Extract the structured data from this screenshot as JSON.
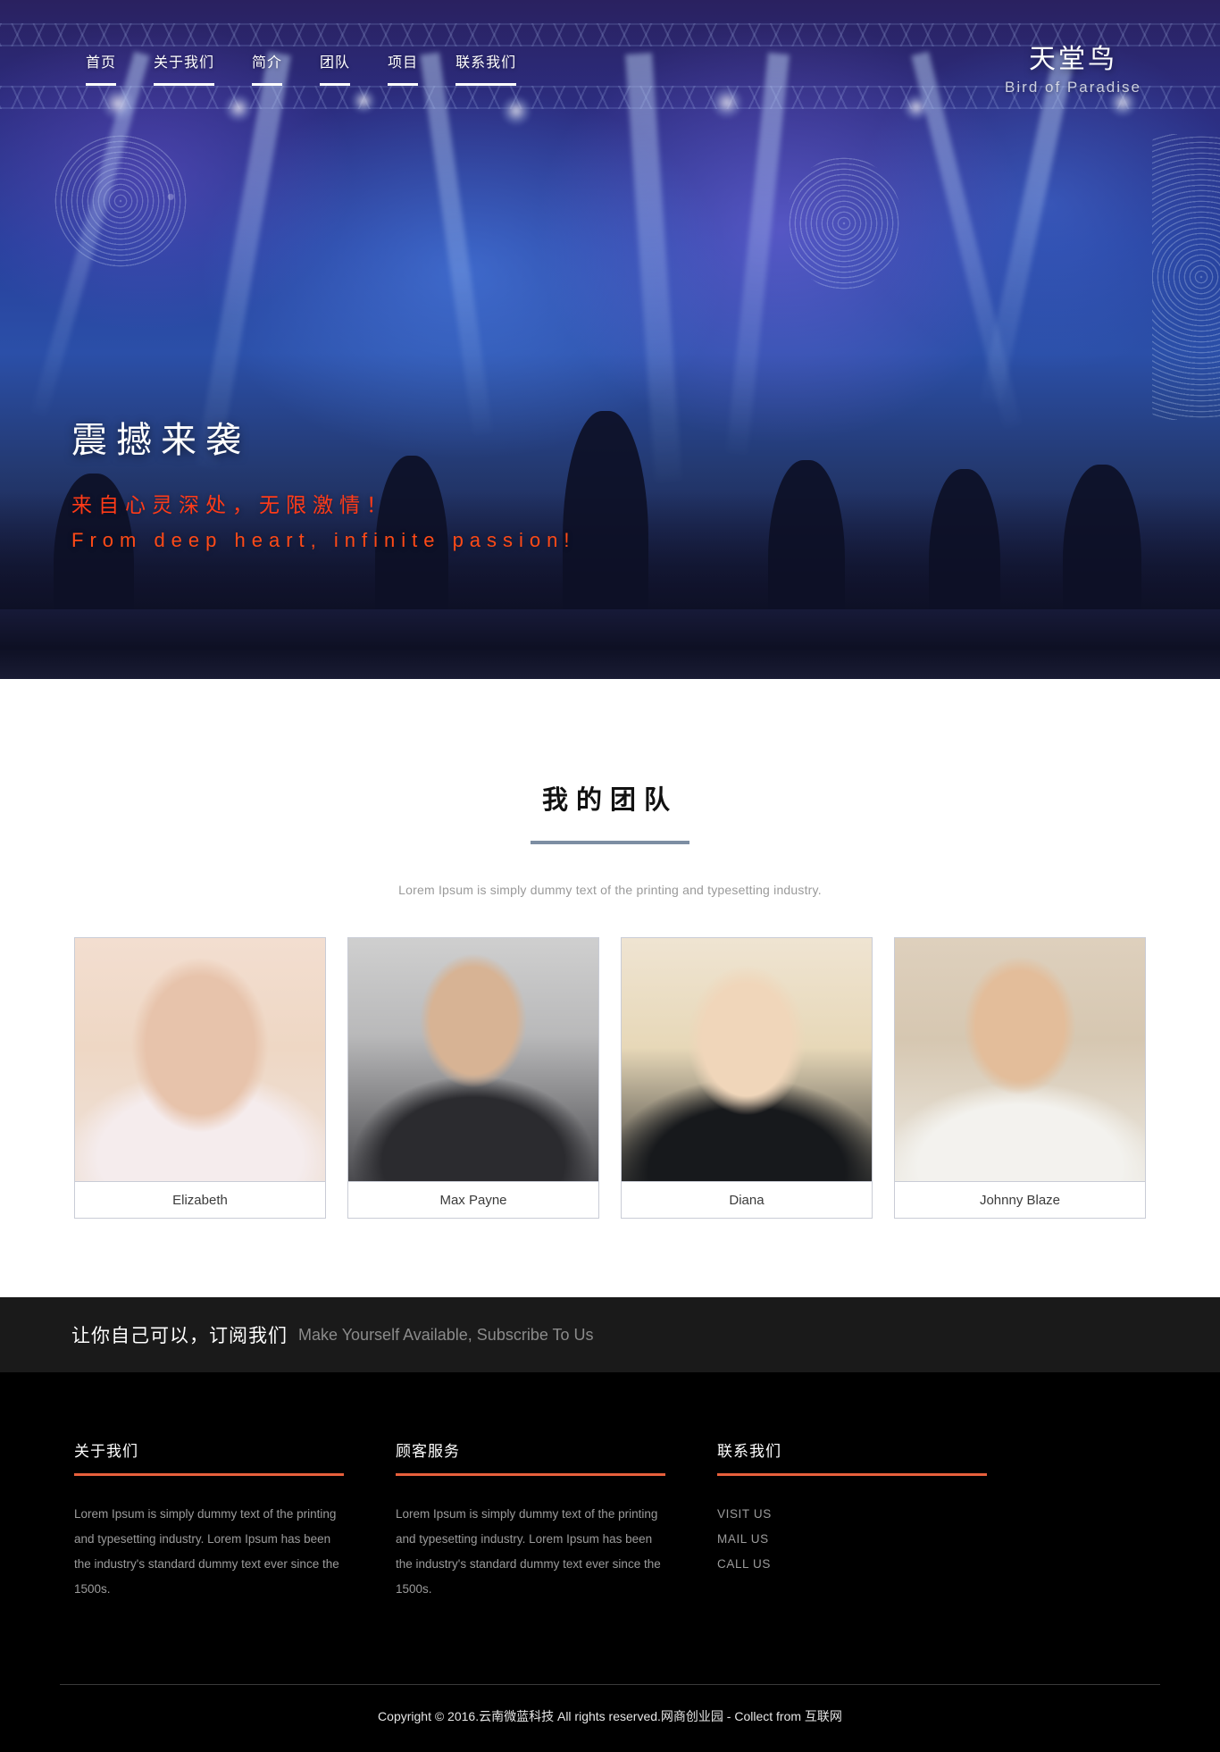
{
  "nav": {
    "items": [
      {
        "label": "首页"
      },
      {
        "label": "关于我们"
      },
      {
        "label": "简介"
      },
      {
        "label": "团队"
      },
      {
        "label": "项目"
      },
      {
        "label": "联系我们"
      }
    ]
  },
  "logo": {
    "cn": "天堂鸟",
    "en": "Bird of Paradise"
  },
  "hero": {
    "title": "震撼来袭",
    "subtitle_cn": "来自心灵深处，无限激情！",
    "subtitle_en": "From deep heart, infinite passion!"
  },
  "team": {
    "title": "我的团队",
    "subtitle": "Lorem Ipsum is simply dummy text of the printing and typesetting industry.",
    "members": [
      {
        "name": "Elizabeth"
      },
      {
        "name": "Max Payne"
      },
      {
        "name": "Diana"
      },
      {
        "name": "Johnny Blaze"
      }
    ]
  },
  "subscribe": {
    "cn": "让你自己可以，订阅我们",
    "en": "Make Yourself Available, Subscribe To Us"
  },
  "footer": {
    "columns": [
      {
        "title": "关于我们",
        "body": "Lorem Ipsum is simply dummy text of the printing and typesetting industry. Lorem Ipsum has been the industry's standard dummy text ever since the 1500s."
      },
      {
        "title": "顾客服务",
        "body": "Lorem Ipsum is simply dummy text of the printing and typesetting industry. Lorem Ipsum has been the industry's standard dummy text ever since the 1500s."
      },
      {
        "title": "联系我们",
        "links": [
          {
            "label": "VISIT US"
          },
          {
            "label": "MAIL US"
          },
          {
            "label": "CALL US"
          }
        ]
      }
    ],
    "copyright": "Copyright © 2016.云南微蓝科技 All rights reserved.网商创业园 - Collect from 互联网"
  },
  "colors": {
    "accent_orange": "#e8603c",
    "hero_red": "#ff3b18",
    "rule_slate": "#7d8ea3",
    "dark_bar": "#1a1a1a"
  }
}
